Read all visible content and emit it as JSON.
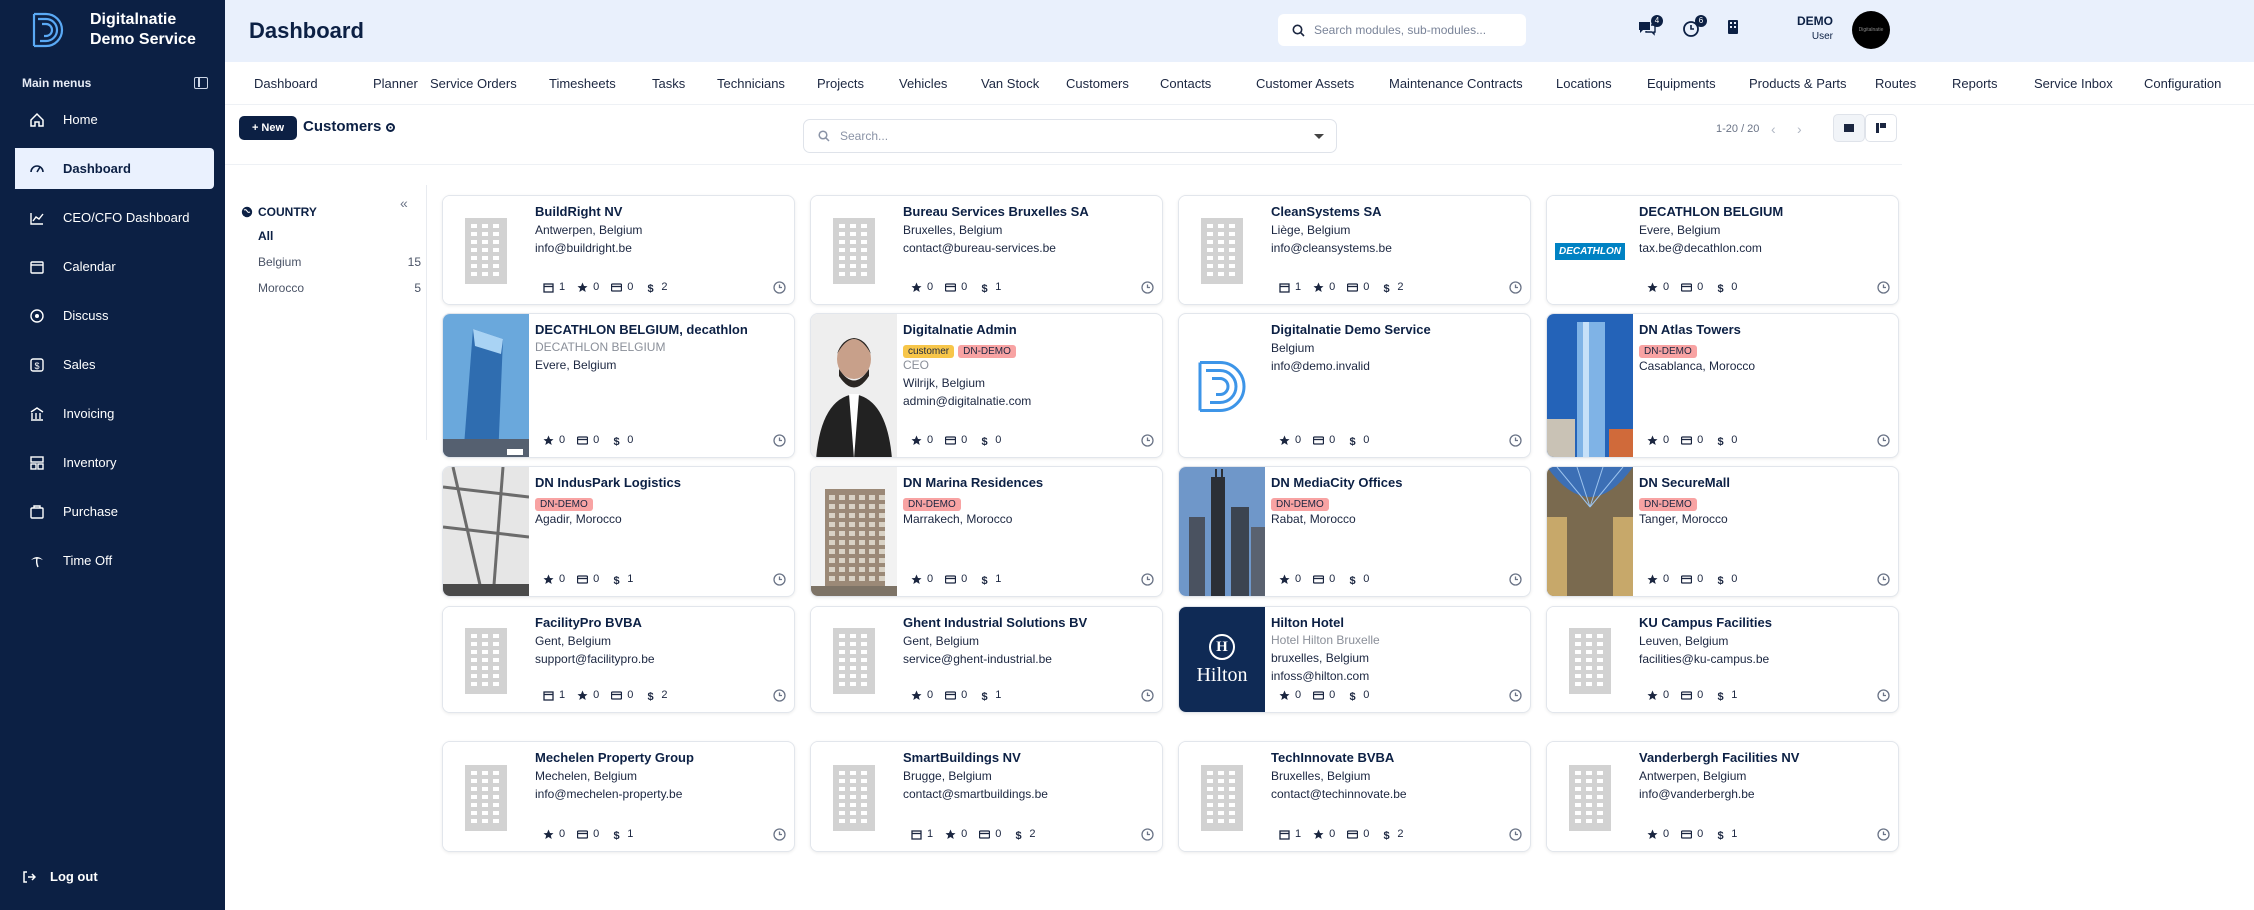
{
  "brand": {
    "line1": "Digitalnatie",
    "line2": "Demo Service"
  },
  "sidebar": {
    "section_label": "Main menus",
    "items": [
      {
        "label": "Home",
        "icon": "home-icon"
      },
      {
        "label": "Dashboard",
        "icon": "gauge-icon",
        "active": true
      },
      {
        "label": "CEO/CFO Dashboard",
        "icon": "trend-icon"
      },
      {
        "label": "Calendar",
        "icon": "calendar-icon"
      },
      {
        "label": "Discuss",
        "icon": "chat-icon"
      },
      {
        "label": "Sales",
        "icon": "dollar-icon"
      },
      {
        "label": "Invoicing",
        "icon": "invoice-icon"
      },
      {
        "label": "Inventory",
        "icon": "inventory-icon"
      },
      {
        "label": "Purchase",
        "icon": "cart-icon"
      },
      {
        "label": "Time Off",
        "icon": "palm-icon"
      }
    ],
    "logout": "Log out"
  },
  "header": {
    "title": "Dashboard",
    "search_placeholder": "Search modules, sub-modules...",
    "msg_count": "4",
    "activity_count": "6",
    "user_name": "DEMO",
    "user_role": "User",
    "avatar_text": "Digitalnatie"
  },
  "menu": [
    "Dashboard",
    "Planner",
    "Service Orders",
    "Timesheets",
    "Tasks",
    "Technicians",
    "Projects",
    "Vehicles",
    "Van Stock",
    "Customers",
    "Contacts",
    "Customer Assets",
    "Maintenance Contracts",
    "Locations",
    "Equipments",
    "Products & Parts",
    "Routes",
    "Reports",
    "Service Inbox",
    "Configuration"
  ],
  "controls": {
    "new_label": "+ New",
    "title": "Customers",
    "search_placeholder": "Search...",
    "pager": "1-20 / 20"
  },
  "filter": {
    "heading": "COUNTRY",
    "rows": [
      {
        "label": "All",
        "count": ""
      },
      {
        "label": "Belgium",
        "count": "15"
      },
      {
        "label": "Morocco",
        "count": "5"
      }
    ]
  },
  "colors": {
    "sidebar": "#0c2044",
    "topbar": "#e9f0fc",
    "tag_demo": "#f8a3a3",
    "tag_customer": "#f7c64a"
  },
  "customers": [
    {
      "name": "BuildRight NV",
      "lines": [
        "Antwerpen, Belgium",
        "info@buildright.be"
      ],
      "stats": {
        "cal": "1",
        "star": "0",
        "card": "0",
        "dollar": "2"
      },
      "image": "building-placeholder"
    },
    {
      "name": "Bureau Services Bruxelles SA",
      "lines": [
        "Bruxelles, Belgium",
        "contact@bureau-services.be"
      ],
      "stats": {
        "star": "0",
        "card": "0",
        "dollar": "1"
      },
      "image": "building-placeholder"
    },
    {
      "name": "CleanSystems SA",
      "lines": [
        "Liège, Belgium",
        "info@cleansystems.be"
      ],
      "stats": {
        "cal": "1",
        "star": "0",
        "card": "0",
        "dollar": "2"
      },
      "image": "building-placeholder"
    },
    {
      "name": "DECATHLON BELGIUM",
      "lines": [
        "Evere, Belgium",
        "tax.be@decathlon.com"
      ],
      "stats": {
        "star": "0",
        "card": "0",
        "dollar": "0"
      },
      "image": "decathlon-logo",
      "logo_text": "DECATHLON"
    },
    {
      "name": "DECATHLON BELGIUM, decathlon",
      "sub": "DECATHLON BELGIUM",
      "lines": [
        "Evere, Belgium"
      ],
      "stats": {
        "star": "0",
        "card": "0",
        "dollar": "0"
      },
      "image": "glass-tower-photo"
    },
    {
      "name": "Digitalnatie Admin",
      "tags": [
        {
          "text": "customer",
          "color": "yellow"
        },
        {
          "text": "DN-DEMO",
          "color": "red"
        }
      ],
      "sub": "CEO",
      "lines": [
        "Wilrijk, Belgium",
        "admin@digitalnatie.com"
      ],
      "stats": {
        "star": "0",
        "card": "0",
        "dollar": "0"
      },
      "image": "person-photo"
    },
    {
      "name": "Digitalnatie Demo Service",
      "lines": [
        "Belgium",
        "info@demo.invalid"
      ],
      "stats": {
        "star": "0",
        "card": "0",
        "dollar": "0"
      },
      "image": "digitalnatie-logo"
    },
    {
      "name": "DN Atlas Towers",
      "tags": [
        {
          "text": "DN-DEMO",
          "color": "red"
        }
      ],
      "lines": [
        "Casablanca, Morocco"
      ],
      "stats": {
        "star": "0",
        "card": "0",
        "dollar": "0"
      },
      "image": "blue-tower-photo"
    },
    {
      "name": "DN IndusPark Logistics",
      "tags": [
        {
          "text": "DN-DEMO",
          "color": "red"
        }
      ],
      "lines": [
        "Agadir, Morocco"
      ],
      "stats": {
        "star": "0",
        "card": "0",
        "dollar": "1"
      },
      "image": "industrial-photo"
    },
    {
      "name": "DN Marina Residences",
      "tags": [
        {
          "text": "DN-DEMO",
          "color": "red"
        }
      ],
      "lines": [
        "Marrakech, Morocco"
      ],
      "stats": {
        "star": "0",
        "card": "0",
        "dollar": "1"
      },
      "image": "residence-photo"
    },
    {
      "name": "DN MediaCity Offices",
      "tags": [
        {
          "text": "DN-DEMO",
          "color": "red"
        }
      ],
      "lines": [
        "Rabat, Morocco"
      ],
      "stats": {
        "star": "0",
        "card": "0",
        "dollar": "0"
      },
      "image": "skyline-photo"
    },
    {
      "name": "DN SecureMall",
      "tags": [
        {
          "text": "DN-DEMO",
          "color": "red"
        }
      ],
      "lines": [
        "Tanger, Morocco"
      ],
      "stats": {
        "star": "0",
        "card": "0",
        "dollar": "0"
      },
      "image": "mall-photo"
    },
    {
      "name": "FacilityPro BVBA",
      "lines": [
        "Gent, Belgium",
        "support@facilitypro.be"
      ],
      "stats": {
        "cal": "1",
        "star": "0",
        "card": "0",
        "dollar": "2"
      },
      "image": "building-placeholder"
    },
    {
      "name": "Ghent Industrial Solutions BV",
      "lines": [
        "Gent, Belgium",
        "service@ghent-industrial.be"
      ],
      "stats": {
        "star": "0",
        "card": "0",
        "dollar": "1"
      },
      "image": "building-placeholder"
    },
    {
      "name": "Hilton Hotel",
      "sub": "Hotel Hilton Bruxelle",
      "lines": [
        "bruxelles, Belgium",
        "infoss@hilton.com"
      ],
      "stats": {
        "star": "0",
        "card": "0",
        "dollar": "0"
      },
      "image": "hilton-logo",
      "logo_text": "Hilton"
    },
    {
      "name": "KU Campus Facilities",
      "lines": [
        "Leuven, Belgium",
        "facilities@ku-campus.be"
      ],
      "stats": {
        "star": "0",
        "card": "0",
        "dollar": "1"
      },
      "image": "building-placeholder"
    },
    {
      "name": "Mechelen Property Group",
      "lines": [
        "Mechelen, Belgium",
        "info@mechelen-property.be"
      ],
      "stats": {
        "star": "0",
        "card": "0",
        "dollar": "1"
      },
      "image": "building-placeholder"
    },
    {
      "name": "SmartBuildings NV",
      "lines": [
        "Brugge, Belgium",
        "contact@smartbuildings.be"
      ],
      "stats": {
        "cal": "1",
        "star": "0",
        "card": "0",
        "dollar": "2"
      },
      "image": "building-placeholder"
    },
    {
      "name": "TechInnovate BVBA",
      "lines": [
        "Bruxelles, Belgium",
        "contact@techinnovate.be"
      ],
      "stats": {
        "cal": "1",
        "star": "0",
        "card": "0",
        "dollar": "2"
      },
      "image": "building-placeholder"
    },
    {
      "name": "Vanderbergh Facilities NV",
      "lines": [
        "Antwerpen, Belgium",
        "info@vanderbergh.be"
      ],
      "stats": {
        "star": "0",
        "card": "0",
        "dollar": "1"
      },
      "image": "building-placeholder"
    }
  ]
}
